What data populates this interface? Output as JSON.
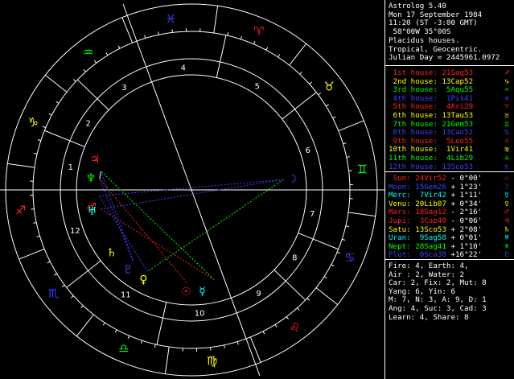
{
  "header": {
    "lines": [
      "Astrolog 5.40",
      "Mon 17 September 1984",
      "11:20 (ST -3:00 GMT)",
      " 58°00W 35°00S",
      "Placidus houses.",
      "Tropical, Geocentric.",
      "Julian Day = 2445961.0972"
    ]
  },
  "houses": [
    {
      "label": "1st house:",
      "value": "21Sag53",
      "color": "#ff2020",
      "glyph": "♐"
    },
    {
      "label": "2nd house:",
      "value": "13Cap52",
      "color": "#ffff00",
      "glyph": "♑"
    },
    {
      "label": "3rd house:",
      "value": "5Aqu55",
      "color": "#00ff00",
      "glyph": "♒"
    },
    {
      "label": "4th house:",
      "value": "1Pis41",
      "color": "#4040ff",
      "glyph": "♓"
    },
    {
      "label": "5th house:",
      "value": "4Ari29",
      "color": "#ff2020",
      "glyph": "♈"
    },
    {
      "label": "6th house:",
      "value": "13Tau53",
      "color": "#ffff00",
      "glyph": "♉"
    },
    {
      "label": "7th house:",
      "value": "21Gem53",
      "color": "#00ff00",
      "glyph": "♊"
    },
    {
      "label": "8th house:",
      "value": "13Can52",
      "color": "#4040ff",
      "glyph": "♋"
    },
    {
      "label": "9th house:",
      "value": "5Leo55",
      "color": "#ff2020",
      "glyph": "♌"
    },
    {
      "label": "10th house:",
      "value": "1Vir41",
      "color": "#ffff00",
      "glyph": "♍"
    },
    {
      "label": "11th house:",
      "value": "4Lib29",
      "color": "#00ff00",
      "glyph": "♎"
    },
    {
      "label": "12th house:",
      "value": "13Sco53",
      "color": "#4040ff",
      "glyph": "♏"
    }
  ],
  "planets": [
    {
      "name": "Sun:",
      "pos": "24Vir52",
      "decl": "- 0°00'",
      "color": "#ff2020",
      "glyph": "☉"
    },
    {
      "name": "Moon:",
      "pos": "15Gem26",
      "decl": "+ 1°23'",
      "color": "#4040ff",
      "glyph": "☽"
    },
    {
      "name": "Merc:",
      "pos": "7Vir42",
      "decl": "+ 1°11'",
      "color": "#00ffff",
      "glyph": "☿"
    },
    {
      "name": "Venu:",
      "pos": "20Lib07",
      "decl": "+ 0°34'",
      "color": "#ffff00",
      "glyph": "♀"
    },
    {
      "name": "Mars:",
      "pos": "18Sag12",
      "decl": "- 2°16'",
      "color": "#ff2020",
      "glyph": "♂"
    },
    {
      "name": "Jupi:",
      "pos": "3Cap40",
      "decl": "- 0°06'",
      "color": "#ff2020",
      "glyph": "♃"
    },
    {
      "name": "Satu:",
      "pos": "13Sco53",
      "decl": "+ 2°08'",
      "color": "#ffff00",
      "glyph": "♄"
    },
    {
      "name": "Uran:",
      "pos": "9Sag58",
      "decl": "+ 0°01'",
      "color": "#00ffff",
      "glyph": "♅"
    },
    {
      "name": "Nept:",
      "pos": "28Sag41",
      "decl": "+ 1°10'",
      "color": "#00ff00",
      "glyph": "♆"
    },
    {
      "name": "Plut:",
      "pos": "0Sco38",
      "decl": "+16°22'",
      "color": "#4040ff",
      "glyph": "♇"
    }
  ],
  "summary": [
    "Fire: 4, Earth: 4,",
    "Air : 2, Water: 2",
    "Car: 2, Fix: 2, Mut: 8",
    "Yang: 6, Yin: 6",
    "M: 7, N: 3, A: 9, D: 1",
    "Ang: 4, Suc: 3, Cad: 3",
    "Learn: 4, Share: 8"
  ],
  "wheel": {
    "house_numbers": [
      "1",
      "2",
      "3",
      "4",
      "5",
      "6",
      "7",
      "8",
      "9",
      "10",
      "11",
      "12"
    ],
    "signs": [
      {
        "glyph": "♐",
        "color": "#ff2020"
      },
      {
        "glyph": "♑",
        "color": "#ffff00"
      },
      {
        "glyph": "♒",
        "color": "#00ff00"
      },
      {
        "glyph": "♓",
        "color": "#4040ff"
      },
      {
        "glyph": "♈",
        "color": "#ff2020"
      },
      {
        "glyph": "♉",
        "color": "#ffff00"
      },
      {
        "glyph": "♊",
        "color": "#00ff00"
      },
      {
        "glyph": "♋",
        "color": "#4040ff"
      },
      {
        "glyph": "♌",
        "color": "#ff2020"
      },
      {
        "glyph": "♍",
        "color": "#ffff00"
      },
      {
        "glyph": "♎",
        "color": "#00ff00"
      },
      {
        "glyph": "♏",
        "color": "#4040ff"
      }
    ]
  }
}
